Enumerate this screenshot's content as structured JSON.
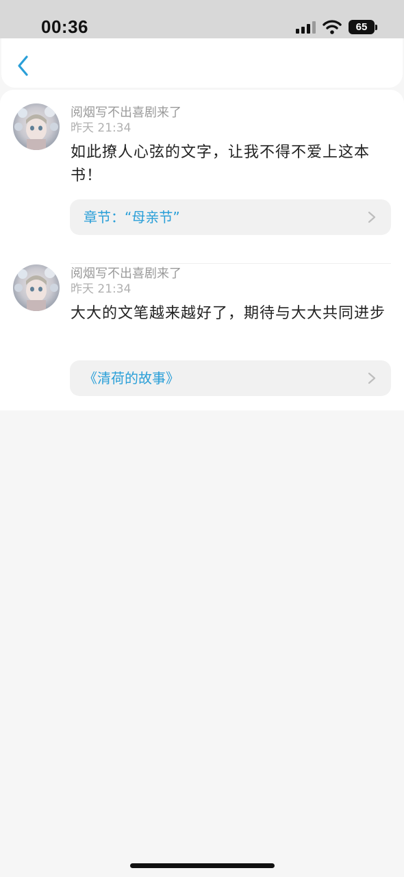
{
  "status_bar": {
    "time": "00:36",
    "battery": "65"
  },
  "colors": {
    "accent": "#2a9fd8",
    "status_bar_bg": "#d8d8d8",
    "page_bg": "#f6f6f6"
  },
  "nav": {
    "back_icon": "chevron-left-icon"
  },
  "comments": [
    {
      "username": "阅烟写不出喜剧来了",
      "timestamp": "昨天 21:34",
      "text": "如此撩人心弦的文字，让我不得不爱上这本书！",
      "link": "章节：“母亲节”"
    },
    {
      "username": "阅烟写不出喜剧来了",
      "timestamp": "昨天 21:34",
      "text": "大大的文笔越来越好了，期待与大大共同进步",
      "link": "《清荷的故事》"
    }
  ]
}
